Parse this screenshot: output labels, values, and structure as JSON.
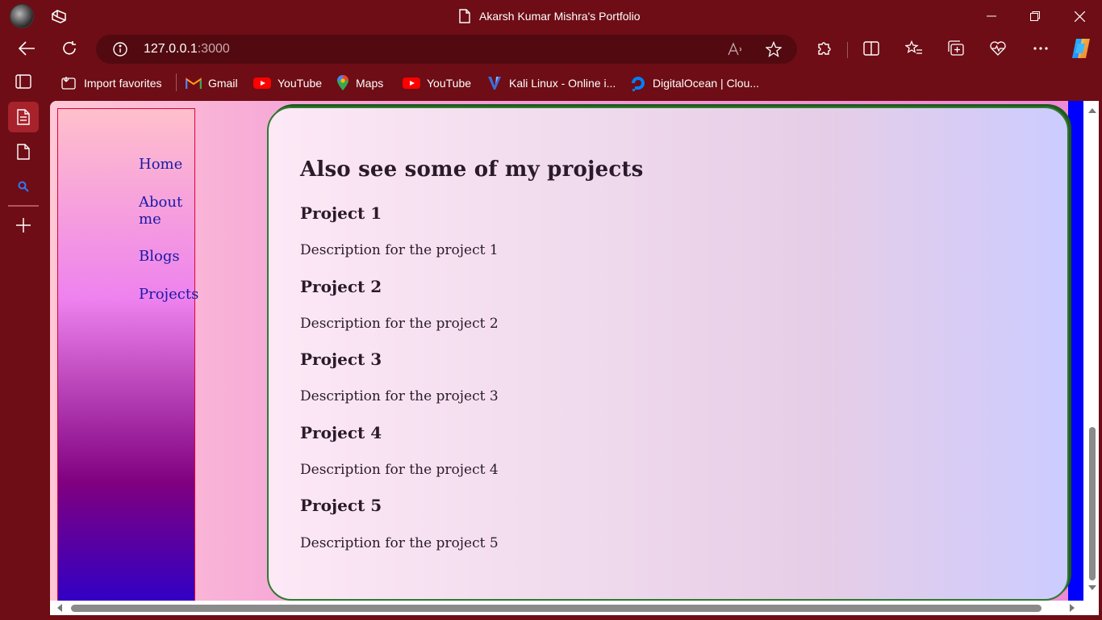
{
  "window": {
    "title": "Akarsh Kumar Mishra's Portfolio"
  },
  "address_bar": {
    "host": "127.0.0.1",
    "port": ":3000"
  },
  "favorites": [
    {
      "label": "Import favorites",
      "icon": "import-favorites-icon"
    },
    {
      "label": "Gmail",
      "icon": "gmail-icon"
    },
    {
      "label": "YouTube",
      "icon": "youtube-icon"
    },
    {
      "label": "Maps",
      "icon": "maps-icon"
    },
    {
      "label": "YouTube",
      "icon": "youtube-icon"
    },
    {
      "label": "Kali Linux - Online i...",
      "icon": "kali-icon"
    },
    {
      "label": "DigitalOcean | Clou...",
      "icon": "digitalocean-icon"
    }
  ],
  "page": {
    "nav": [
      {
        "label": "Home"
      },
      {
        "label": "About me"
      },
      {
        "label": "Blogs"
      },
      {
        "label": "Projects"
      }
    ],
    "heading": "Also see some of my projects",
    "projects": [
      {
        "title": "Project 1",
        "description": "Description for the project 1"
      },
      {
        "title": "Project 2",
        "description": "Description for the project 2"
      },
      {
        "title": "Project 3",
        "description": "Description for the project 3"
      },
      {
        "title": "Project 4",
        "description": "Description for the project 4"
      },
      {
        "title": "Project 5",
        "description": "Description for the project 5"
      }
    ]
  },
  "colors": {
    "browser_frame": "#6e0d15",
    "address_field": "#520a10",
    "nav_link": "#1a1aa6",
    "card_border": "#2f7a2f",
    "page_edge": "#0000ff"
  }
}
